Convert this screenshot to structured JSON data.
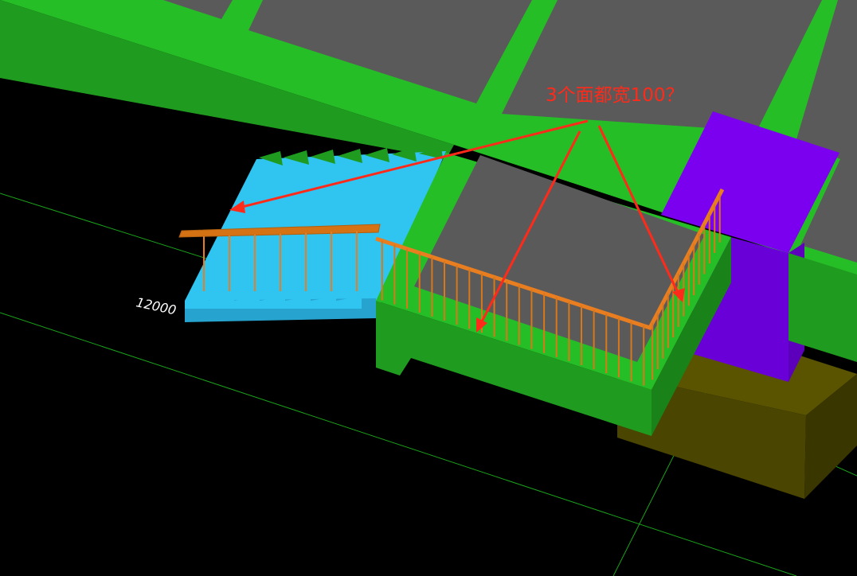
{
  "annotation": {
    "text": "3个面都宽100？",
    "color": "#ff2a1a"
  },
  "dimension_label": "12000",
  "colors": {
    "background": "#000000",
    "slab_green": "#26be26",
    "slab_green_dark": "#1f9c1f",
    "slab_gray": "#5a5a5a",
    "stair_blue": "#30c4f0",
    "stair_blue_dark": "#26a3cf",
    "column_purple": "#7b00f0",
    "column_purple_dark": "#6300c8",
    "footing_olive": "#5a5400",
    "footing_olive_dark": "#3f3a00",
    "railing_orange": "#e87e20",
    "grid_line": "#1aa31a"
  },
  "icons": {
    "arrow": "red-arrow-icon"
  }
}
